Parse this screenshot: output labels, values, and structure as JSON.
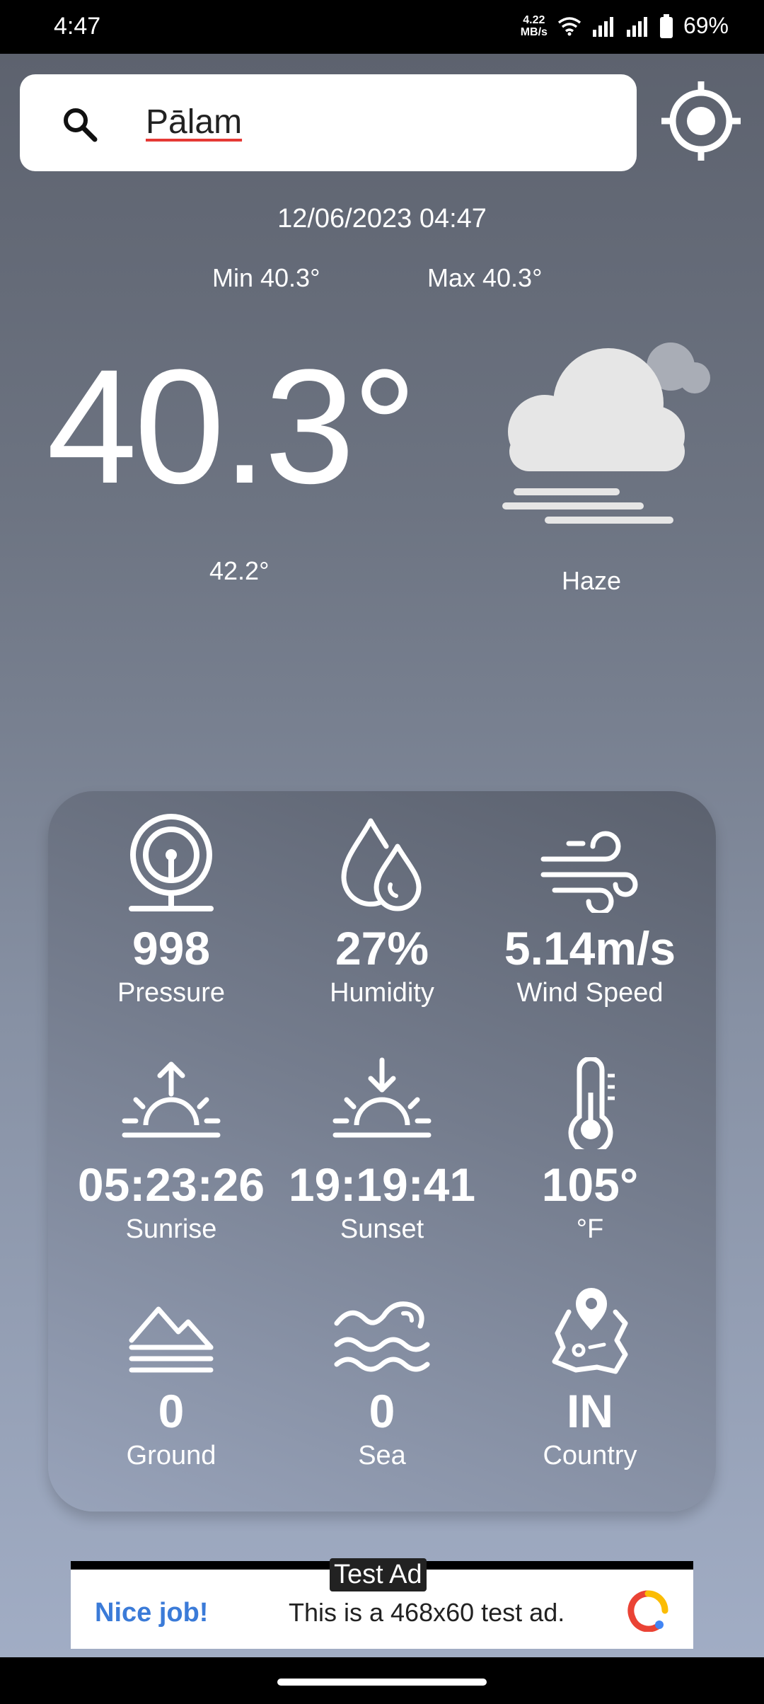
{
  "status_bar": {
    "time": "4:47",
    "speed": "4.22",
    "speed_unit": "MB/s",
    "battery": "69%"
  },
  "search": {
    "value": "Pālam"
  },
  "weather": {
    "datetime": "12/06/2023 04:47",
    "min": "Min 40.3°",
    "max": "Max 40.3°",
    "temperature": "40.3°",
    "feels_like": "42.2°",
    "condition": "Haze",
    "condition_icon": "haze-cloud-icon"
  },
  "details": [
    {
      "icon": "pressure-icon",
      "value": "998",
      "label": "Pressure"
    },
    {
      "icon": "humidity-icon",
      "value": "27%",
      "label": "Humidity"
    },
    {
      "icon": "wind-icon",
      "value": "5.14m/s",
      "label": "Wind Speed"
    },
    {
      "icon": "sunrise-icon",
      "value": "05:23:26",
      "label": "Sunrise"
    },
    {
      "icon": "sunset-icon",
      "value": "19:19:41",
      "label": "Sunset"
    },
    {
      "icon": "thermometer-icon",
      "value": "105°",
      "label": "°F"
    },
    {
      "icon": "ground-icon",
      "value": "0",
      "label": "Ground"
    },
    {
      "icon": "sea-icon",
      "value": "0",
      "label": "Sea"
    },
    {
      "icon": "country-map-icon",
      "value": "IN",
      "label": "Country"
    }
  ],
  "ad": {
    "tag": "Test Ad",
    "headline": "Nice job!",
    "text": "This is a 468x60 test ad."
  }
}
